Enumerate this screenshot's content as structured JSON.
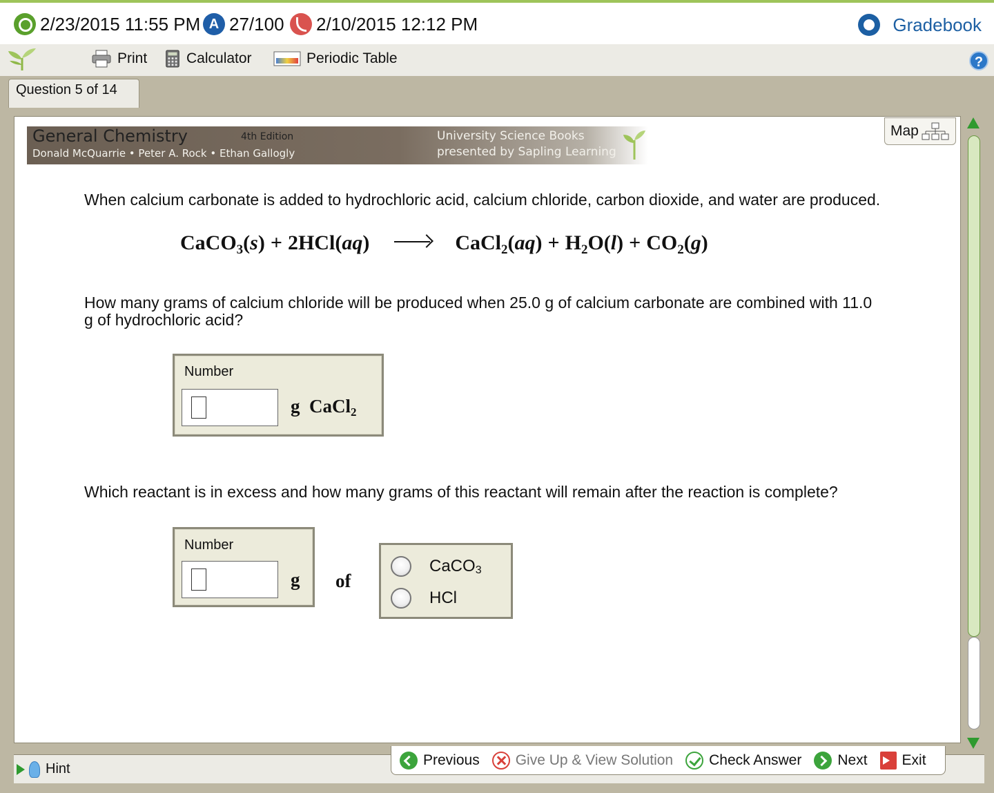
{
  "status": {
    "due_date": "2/23/2015 11:55 PM",
    "score": "27/100",
    "late_date": "2/10/2015 12:12 PM",
    "gradebook_label": "Gradebook"
  },
  "toolbar": {
    "print_label": "Print",
    "calculator_label": "Calculator",
    "periodic_table_label": "Periodic Table",
    "help_label": "?"
  },
  "tab": {
    "question_label": "Question 5 of 14"
  },
  "banner": {
    "title": "General Chemistry",
    "edition": "4th Edition",
    "authors": "Donald McQuarrie • Peter A. Rock • Ethan Gallogly",
    "publisher_line1": "University Science Books",
    "publisher_line2": "presented by Sapling Learning"
  },
  "map_label": "Map",
  "question": {
    "intro": "When calcium carbonate is added to hydrochloric acid, calcium chloride, carbon dioxide, and water are produced.",
    "equation": {
      "r1": "CaCO",
      "r1_sub": "3",
      "r1_state": "s",
      "r2": "2HCl",
      "r2_state": "aq",
      "p1": "CaCl",
      "p1_sub": "2",
      "p1_state": "aq",
      "p2a": "H",
      "p2_sub": "2",
      "p2b": "O",
      "p2_state": "l",
      "p3": "CO",
      "p3_sub": "2",
      "p3_state": "g"
    },
    "part1": "How many grams of calcium chloride will be produced when 25.0 g of calcium carbonate are combined with 11.0 g of hydrochloric acid?",
    "part1_box": {
      "label": "Number",
      "value": "",
      "unit": "g",
      "compound": "CaCl",
      "compound_sub": "2"
    },
    "part2": "Which reactant is in excess and how many grams of this reactant will remain after the reaction is complete?",
    "part2_box": {
      "label": "Number",
      "value": "",
      "unit": "g",
      "of_label": "of"
    },
    "choices": [
      {
        "formula": "CaCO",
        "sub": "3"
      },
      {
        "formula": "HCl",
        "sub": ""
      }
    ]
  },
  "nav": {
    "previous": "Previous",
    "give_up": "Give Up & View Solution",
    "check": "Check Answer",
    "next": "Next",
    "exit": "Exit",
    "hint": "Hint"
  },
  "colors": {
    "accent_green": "#9ec45a",
    "gradebook_blue": "#1c5fa3",
    "frame_tan": "#bdb7a3",
    "box_beige": "#ecebdb"
  },
  "icons": {
    "due": "clock-icon",
    "score": "score-icon",
    "late": "late-icon",
    "gradebook": "gradebook-icon",
    "print": "printer-icon",
    "calculator": "calculator-icon",
    "periodic_table": "periodic-table-icon",
    "map": "map-icon"
  }
}
